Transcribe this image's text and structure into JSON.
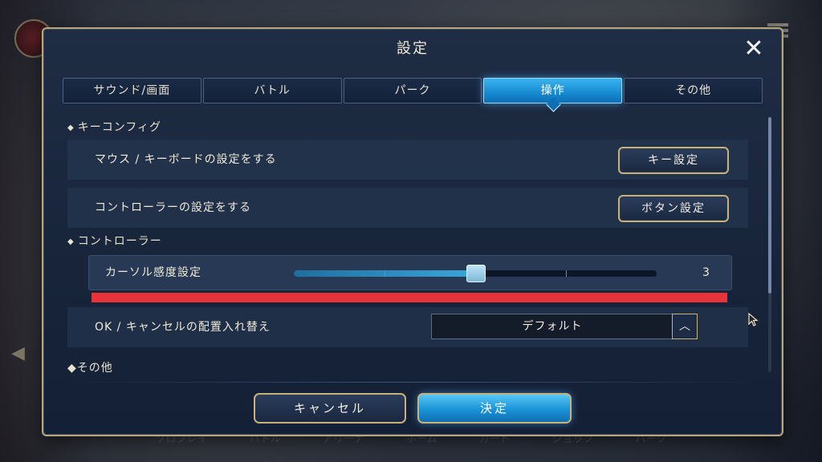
{
  "background": {
    "nav_items": [
      "ソロプレイ",
      "バトル",
      "アリーナ",
      "ホーム",
      "カード",
      "ショップ",
      "パーク"
    ]
  },
  "modal": {
    "title": "設定",
    "close_icon": "close-icon"
  },
  "tabs": [
    {
      "label": "サウンド/画面",
      "active": false
    },
    {
      "label": "バトル",
      "active": false
    },
    {
      "label": "パーク",
      "active": false
    },
    {
      "label": "操作",
      "active": true
    },
    {
      "label": "その他",
      "active": false
    }
  ],
  "sections": {
    "key_config": {
      "heading": "キーコンフィグ",
      "mouse_row_label": "マウス / キーボードの設定をする",
      "mouse_button": "キー設定",
      "controller_row_label": "コントローラーの設定をする",
      "controller_button": "ボタン設定"
    },
    "controller": {
      "heading": "コントローラー",
      "cursor_label": "カーソル感度設定",
      "cursor_value": "3",
      "cursor_value_fraction": 0.5,
      "swap_label": "OK / キャンセルの配置入れ替え",
      "swap_value": "デフォルト"
    },
    "other": {
      "heading": "その他"
    }
  },
  "footer": {
    "cancel_label": "キャンセル",
    "ok_label": "決定"
  },
  "colors": {
    "accent_blue": "#1a92d6",
    "gold_border": "#c8b27c",
    "highlight_red": "#e8333a"
  }
}
